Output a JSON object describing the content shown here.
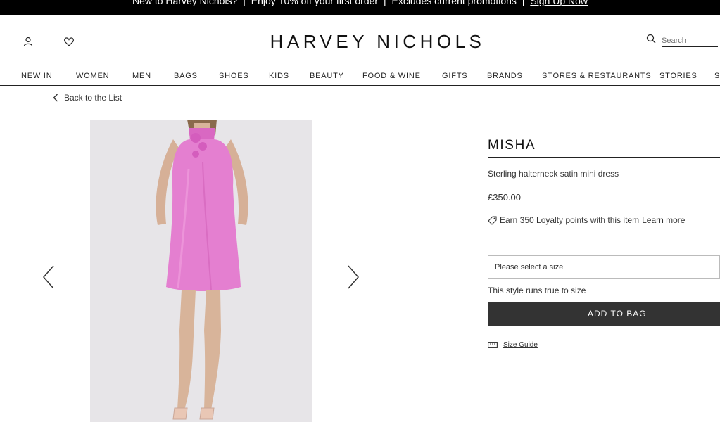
{
  "promo": {
    "part1": "New to Harvey Nichols?",
    "sep": "|",
    "part2": "Enjoy 10% off your first order",
    "part3": "Excludes current promotions",
    "link": "Sign Up Now"
  },
  "header": {
    "logo": "HARVEY NICHOLS",
    "search_placeholder": "Search"
  },
  "nav": [
    "NEW IN",
    "WOMEN",
    "MEN",
    "BAGS",
    "SHOES",
    "KIDS",
    "BEAUTY",
    "FOOD & WINE",
    "GIFTS",
    "BRANDS",
    "STORES & RESTAURANTS",
    "STORIES",
    "SALE"
  ],
  "breadcrumb": {
    "back_label": "Back to the List"
  },
  "product": {
    "brand": "MISHA",
    "description": "Sterling halterneck satin mini dress",
    "price": "£350.00",
    "loyalty_text": "Earn 350 Loyalty points with this item",
    "loyalty_link": "Learn more",
    "size_placeholder": "Please select a size",
    "fit_note": "This style runs true to size",
    "add_to_bag": "ADD TO BAG",
    "size_guide": "Size Guide"
  },
  "icons": {
    "account": "user-icon",
    "wishlist": "heart-icon",
    "search": "search-icon",
    "back": "chevron-left-icon",
    "prev": "chevron-left-icon",
    "next": "chevron-right-icon",
    "loyalty": "tag-icon",
    "size_guide": "ruler-icon"
  },
  "colors": {
    "promo_bg": "#000000",
    "button_bg": "#333333",
    "dress": "#e47fd0",
    "photo_bg": "#e7e5e8"
  }
}
